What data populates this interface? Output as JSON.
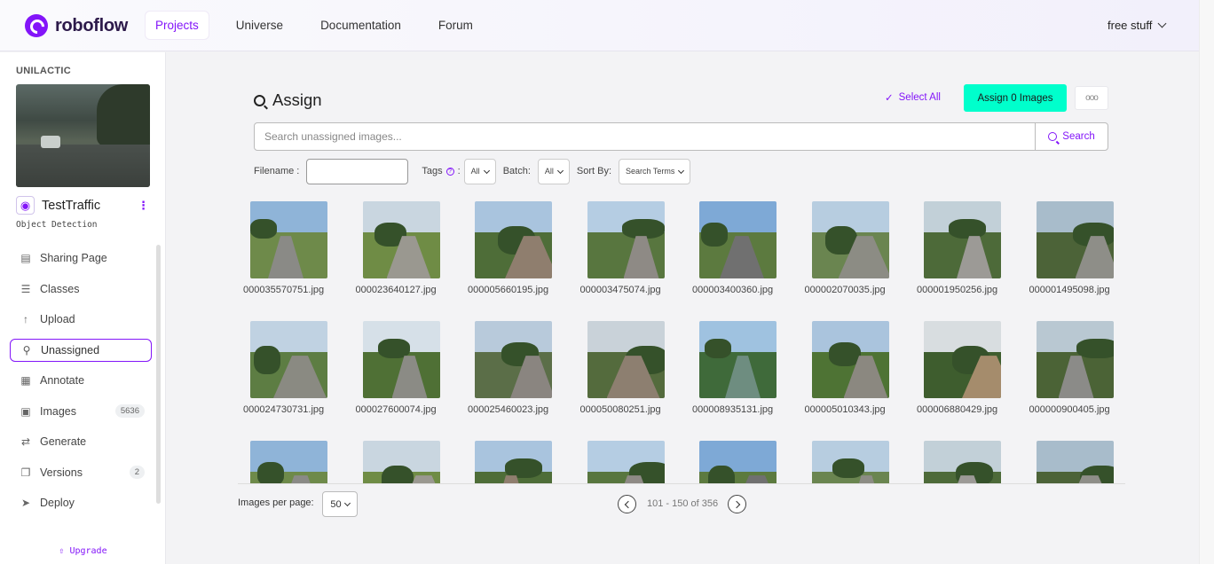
{
  "brand": {
    "name": "roboflow",
    "color": "#8315f9"
  },
  "nav": [
    {
      "label": "Projects",
      "active": true
    },
    {
      "label": "Universe",
      "active": false
    },
    {
      "label": "Documentation",
      "active": false
    },
    {
      "label": "Forum",
      "active": false
    }
  ],
  "user_menu": {
    "label": "free stuff"
  },
  "sidebar": {
    "workspace": "UNILACTIC",
    "project_name": "TestTraffic",
    "project_type": "Object Detection",
    "items": [
      {
        "label": "Sharing Page",
        "icon": "document-icon",
        "badge": ""
      },
      {
        "label": "Classes",
        "icon": "list-icon",
        "badge": ""
      },
      {
        "label": "Upload",
        "icon": "arrow-up-icon",
        "badge": ""
      },
      {
        "label": "Unassigned",
        "icon": "search-icon",
        "badge": "",
        "active": true
      },
      {
        "label": "Annotate",
        "icon": "annotate-icon",
        "badge": ""
      },
      {
        "label": "Images",
        "icon": "image-icon",
        "badge": "5636"
      },
      {
        "label": "Generate",
        "icon": "generate-icon",
        "badge": ""
      },
      {
        "label": "Versions",
        "icon": "versions-icon",
        "badge": "2"
      },
      {
        "label": "Deploy",
        "icon": "rocket-icon",
        "badge": ""
      }
    ],
    "upgrade_label": "Upgrade"
  },
  "main": {
    "title": "Assign",
    "select_all_label": "Select All",
    "assign_button_label": "Assign 0 Images",
    "assign_button_color": "#00ffcc",
    "more_label": "ooo",
    "search_placeholder": "Search unassigned images...",
    "search_button_label": "Search",
    "filters": {
      "filename_label": "Filename :",
      "tags_label": "Tags",
      "tags_value": "All",
      "batch_label": "Batch:",
      "batch_value": "All",
      "sort_label": "Sort By:",
      "sort_value": "Search Terms"
    },
    "images": [
      "000035570751.jpg",
      "000023640127.jpg",
      "000005660195.jpg",
      "000003475074.jpg",
      "000003400360.jpg",
      "000002070035.jpg",
      "000001950256.jpg",
      "000001495098.jpg",
      "000024730731.jpg",
      "000027600074.jpg",
      "000025460023.jpg",
      "000050080251.jpg",
      "000008935131.jpg",
      "000005010343.jpg",
      "000006880429.jpg",
      "000000900405.jpg",
      "",
      "",
      "",
      "",
      "",
      "",
      "",
      ""
    ]
  },
  "pagination": {
    "per_page_label": "Images per page:",
    "per_page_value": "50",
    "range_text": "101 - 150 of 356"
  }
}
